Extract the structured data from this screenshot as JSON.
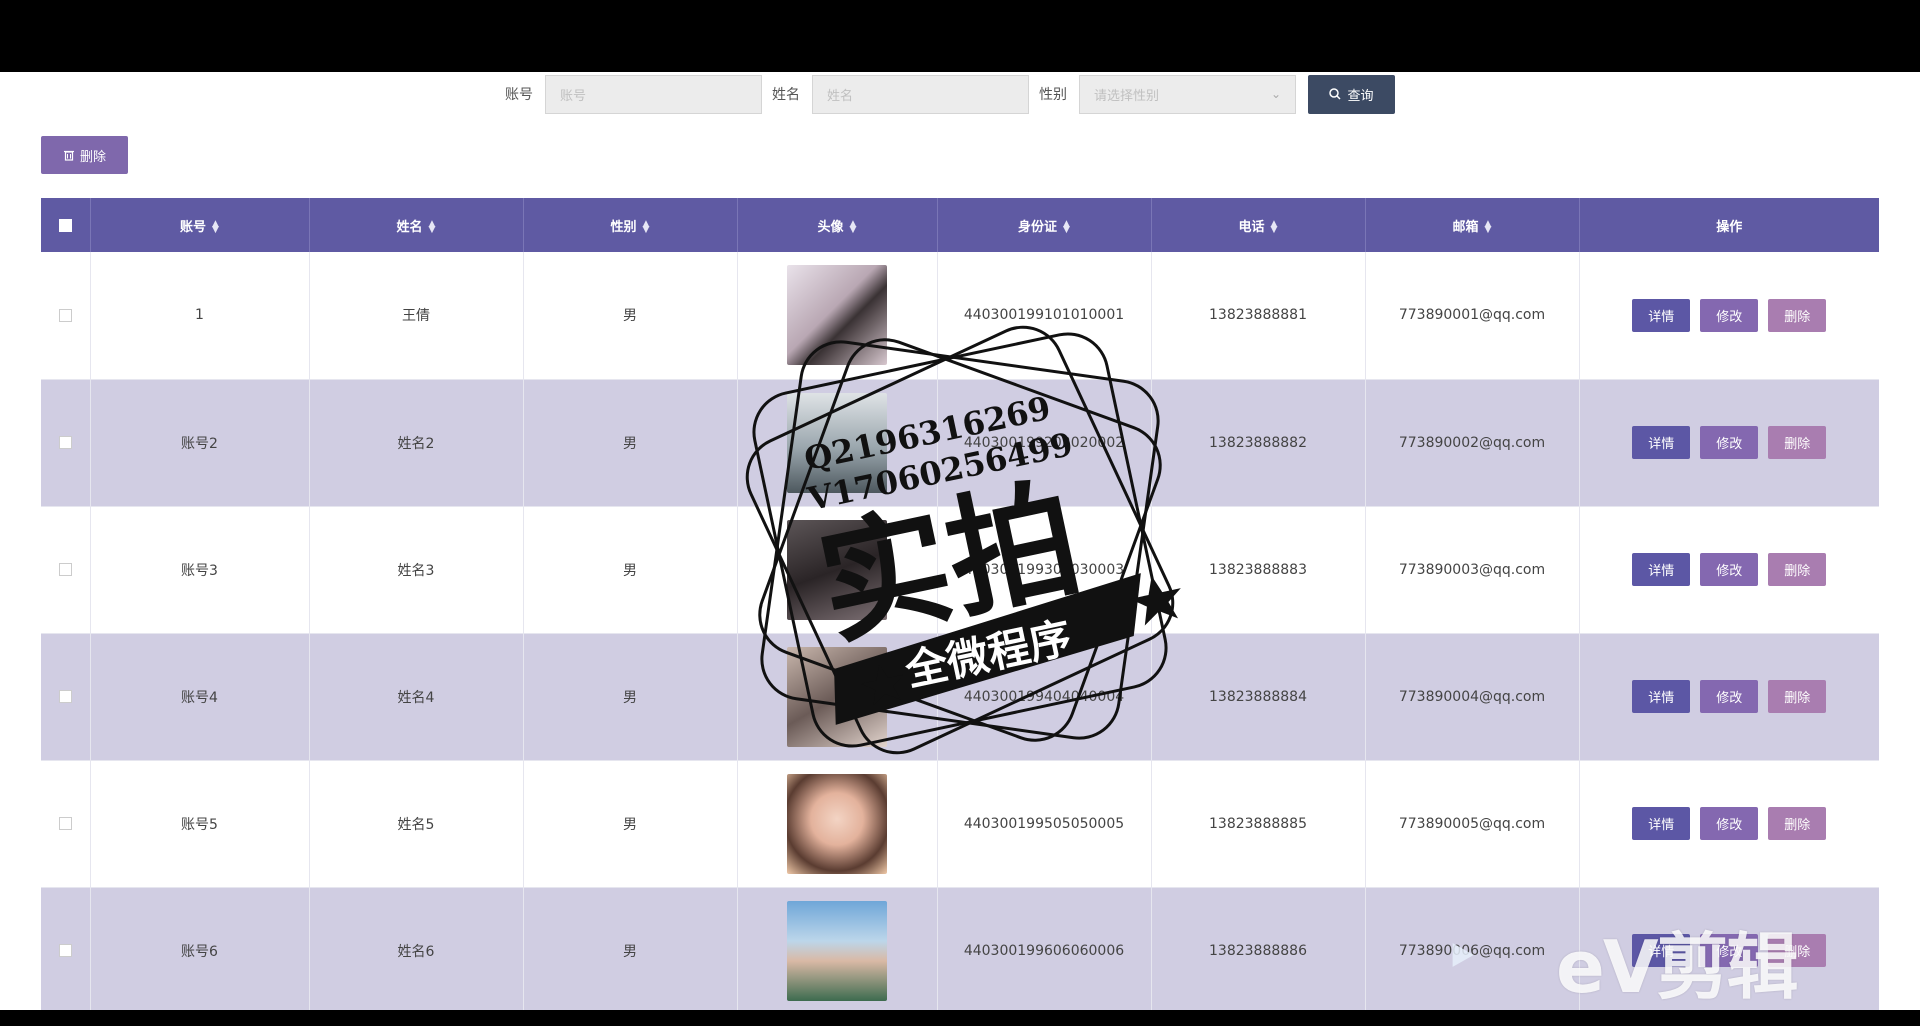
{
  "search": {
    "account_label": "账号",
    "account_placeholder": "账号",
    "name_label": "姓名",
    "name_placeholder": "姓名",
    "gender_label": "性别",
    "gender_placeholder": "请选择性别",
    "query_label": "查询"
  },
  "toolbar": {
    "delete_label": "删除"
  },
  "table": {
    "headers": {
      "account": "账号",
      "name": "姓名",
      "gender": "性别",
      "avatar": "头像",
      "id_card": "身份证",
      "phone": "电话",
      "email": "邮箱",
      "actions": "操作"
    },
    "actions": {
      "detail": "详情",
      "edit": "修改",
      "delete": "删除"
    },
    "rows": [
      {
        "account": "1",
        "name": "王倩",
        "gender": "男",
        "id_card": "440300199101010001",
        "phone": "13823888881",
        "email": "773890001@qq.com"
      },
      {
        "account": "账号2",
        "name": "姓名2",
        "gender": "男",
        "id_card": "440300199202020002",
        "phone": "13823888882",
        "email": "773890002@qq.com"
      },
      {
        "account": "账号3",
        "name": "姓名3",
        "gender": "男",
        "id_card": "440300199303030003",
        "phone": "13823888883",
        "email": "773890003@qq.com"
      },
      {
        "account": "账号4",
        "name": "姓名4",
        "gender": "男",
        "id_card": "440300199404040004",
        "phone": "13823888884",
        "email": "773890004@qq.com"
      },
      {
        "account": "账号5",
        "name": "姓名5",
        "gender": "男",
        "id_card": "440300199505050005",
        "phone": "13823888885",
        "email": "773890005@qq.com"
      },
      {
        "account": "账号6",
        "name": "姓名6",
        "gender": "男",
        "id_card": "440300199606060006",
        "phone": "13823888886",
        "email": "773890006@qq.com"
      }
    ]
  },
  "watermark": {
    "line1": "Q2196316269",
    "line2": "V17060256499",
    "big": "实拍",
    "banner": "全微程序"
  },
  "editor_mark": {
    "text": "eV剪辑"
  },
  "colors": {
    "header_bg": "#5f5aa3",
    "even_row_bg": "#d0cde2",
    "query_btn": "#3c4a63",
    "delete_btn": "#7f68ac",
    "detail_btn": "#5c57a5",
    "edit_btn": "#8468b0",
    "row_delete_btn": "#a97db0"
  }
}
